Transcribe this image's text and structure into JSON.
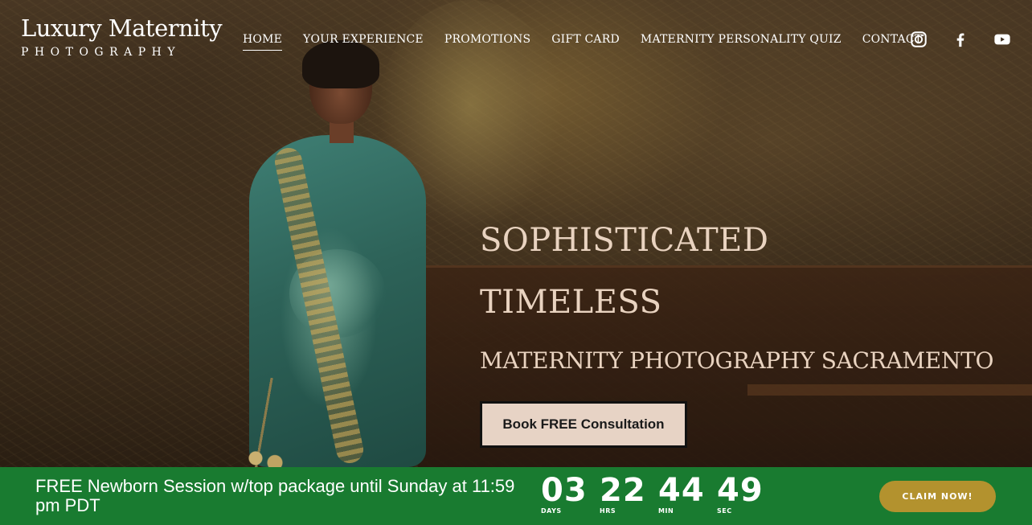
{
  "brand": {
    "line1": "Luxury Maternity",
    "line2": "PHOTOGRAPHY"
  },
  "nav": {
    "items": [
      {
        "label": "HOME",
        "active": true
      },
      {
        "label": "YOUR EXPERIENCE",
        "active": false
      },
      {
        "label": "PROMOTIONS",
        "active": false
      },
      {
        "label": "GIFT CARD",
        "active": false
      },
      {
        "label": "MATERNITY PERSONALITY QUIZ",
        "active": false
      },
      {
        "label": "CONTACT",
        "active": false
      }
    ]
  },
  "socials": [
    {
      "icon": "instagram-icon"
    },
    {
      "icon": "facebook-icon"
    },
    {
      "icon": "youtube-icon"
    }
  ],
  "hero": {
    "line1": "SOPHISTICATED",
    "line2": "TIMELESS",
    "line3": "MATERNITY PHOTOGRAPHY SACRAMENTO",
    "cta_label": "Book FREE Consultation"
  },
  "promo": {
    "message": "FREE Newborn Session w/top package until Sunday at 11:59 pm PDT",
    "countdown": [
      {
        "value": "03",
        "label": "DAYS"
      },
      {
        "value": "22",
        "label": "HRS"
      },
      {
        "value": "44",
        "label": "MIN"
      },
      {
        "value": "49",
        "label": "SEC"
      }
    ],
    "claim_label": "CLAIM NOW!"
  },
  "colors": {
    "promo_bg": "#197b30",
    "claim_bg": "#b3922e",
    "hero_text": "#e9d3c0",
    "cta_bg": "#e7d3c5"
  }
}
